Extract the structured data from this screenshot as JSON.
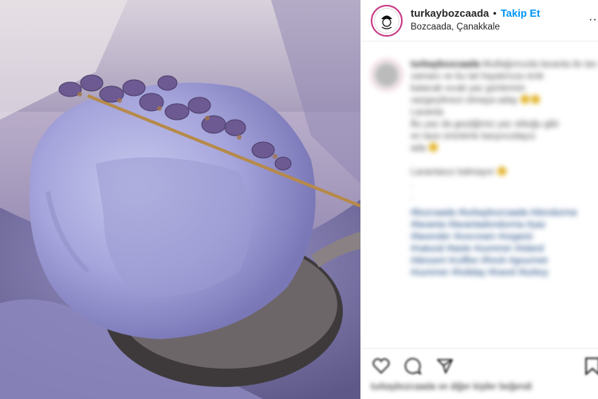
{
  "header": {
    "username": "turkaybozcaada",
    "separator": "•",
    "follow_label": "Takip Et",
    "location": "Bozcaada, Çanakkale",
    "more": "···"
  },
  "caption": {
    "username": "turkaybozcaada",
    "lines": [
      "Mutfağımızda lavanta ile tanışma",
      "zamanı ve bu tat hayatınıza renk",
      "katacak sıcak yaz günlerinin",
      "vazgeçilmezi olmaya aday",
      "Lavanta",
      "Bu yaz da geçtiğimiz yaz olduğu gibi",
      "en taze ürünlerle karşınızdayız",
      "ada",
      "Lavantasız kalmayın",
      ".",
      "."
    ],
    "hashtags": [
      "#bozcaada #turkaybozcaada #dondurma",
      "#lavanta #lavantadondurma #yaz",
      "#lavender #icecream #organic",
      "#natural #taste #summer #island",
      "#dessert #coffee #fresh #gourmet",
      "#summer #holiday #travel #turkey"
    ]
  },
  "actions": {
    "icons": [
      "heart-icon",
      "comment-icon",
      "share-icon",
      "bookmark-icon"
    ],
    "likes_text": "turkaybozcaada ve diğer kişiler beğendi"
  },
  "colors": {
    "follow": "#0095f6",
    "hashtag": "#0f3d7a",
    "story_ring": "#c83a86"
  }
}
